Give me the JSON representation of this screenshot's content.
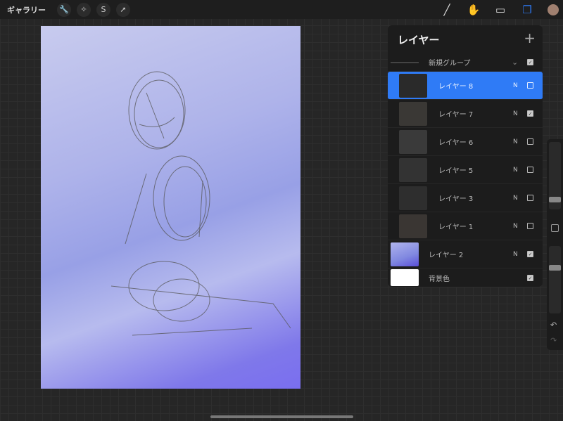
{
  "topbar": {
    "gallery": "ギャラリー",
    "left_tools": [
      {
        "icon": "wrench-icon",
        "glyph": "🔧"
      },
      {
        "icon": "magic-wand-icon",
        "glyph": "✧"
      },
      {
        "icon": "selection-icon",
        "glyph": "S"
      },
      {
        "icon": "transform-arrow-icon",
        "glyph": "➚"
      }
    ],
    "right_tools": [
      {
        "icon": "brush-icon",
        "glyph": "╱"
      },
      {
        "icon": "smudge-icon",
        "glyph": "✋"
      },
      {
        "icon": "eraser-icon",
        "glyph": "▭"
      },
      {
        "icon": "layers-icon",
        "glyph": "❐"
      }
    ],
    "accent": "#2f7bf6"
  },
  "layers_panel": {
    "title": "レイヤー",
    "add": "+",
    "group": {
      "name": "新規グループ",
      "chevron": "⌄",
      "visible": true
    },
    "layers": [
      {
        "name": "レイヤー 8",
        "mode": "N",
        "visible": false,
        "selected": true
      },
      {
        "name": "レイヤー 7",
        "mode": "N",
        "visible": true
      },
      {
        "name": "レイヤー 6",
        "mode": "N",
        "visible": false
      },
      {
        "name": "レイヤー 5",
        "mode": "N",
        "visible": false
      },
      {
        "name": "レイヤー 3",
        "mode": "N",
        "visible": false
      },
      {
        "name": "レイヤー 1",
        "mode": "N",
        "visible": false
      },
      {
        "name": "レイヤー 2",
        "mode": "N",
        "visible": true
      },
      {
        "name": "背景色",
        "mode": "",
        "visible": true
      }
    ]
  },
  "sidebar": {
    "undo": "↶",
    "redo": "↷"
  }
}
